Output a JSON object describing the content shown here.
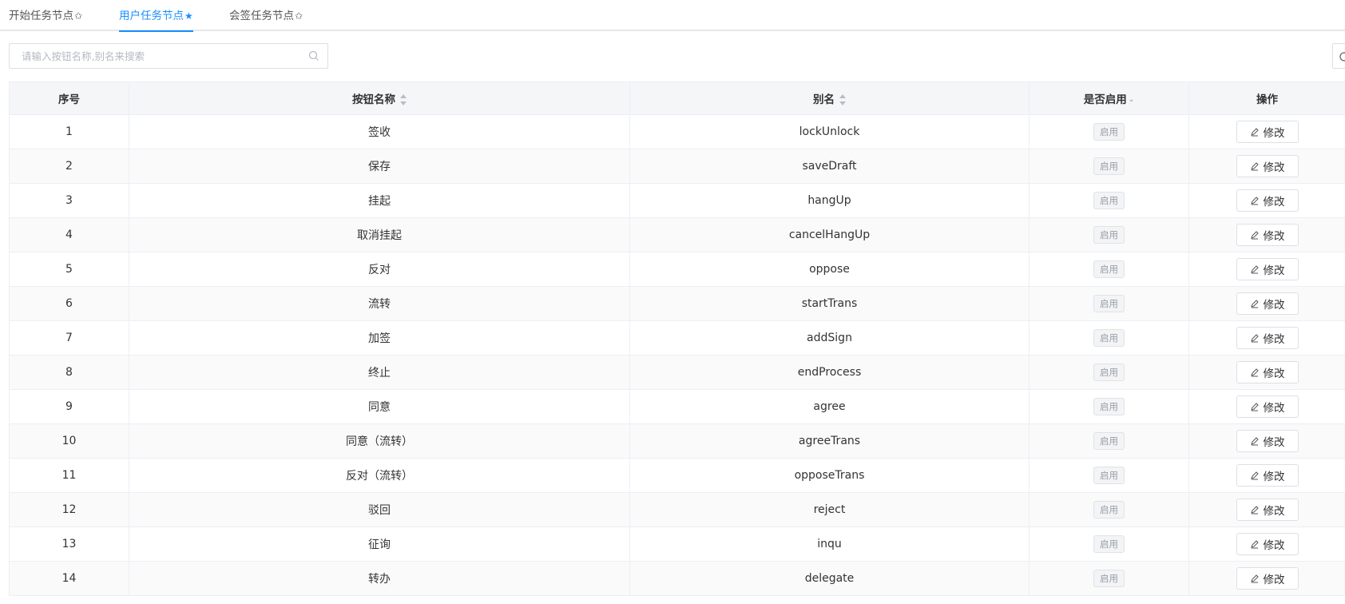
{
  "tabs": [
    {
      "label": "开始任务节点",
      "star": "✩",
      "active": false
    },
    {
      "label": "用户任务节点",
      "star": "★",
      "active": true
    },
    {
      "label": "会签任务节点",
      "star": "✩",
      "active": false
    }
  ],
  "search": {
    "placeholder": "请输入按钮名称,别名来搜索",
    "value": "",
    "icon": "search-icon"
  },
  "toolbar": {
    "refresh_icon": "refresh-icon"
  },
  "table": {
    "columns": [
      "序号",
      "按钮名称",
      "别名",
      "是否启用",
      "操作"
    ],
    "sortable_columns": [
      "按钮名称",
      "别名"
    ],
    "filter_column": "是否启用",
    "rows": [
      {
        "no": "1",
        "name": "签收",
        "alias": "lockUnlock",
        "status": "启用",
        "action": "修改"
      },
      {
        "no": "2",
        "name": "保存",
        "alias": "saveDraft",
        "status": "启用",
        "action": "修改"
      },
      {
        "no": "3",
        "name": "挂起",
        "alias": "hangUp",
        "status": "启用",
        "action": "修改"
      },
      {
        "no": "4",
        "name": "取消挂起",
        "alias": "cancelHangUp",
        "status": "启用",
        "action": "修改"
      },
      {
        "no": "5",
        "name": "反对",
        "alias": "oppose",
        "status": "启用",
        "action": "修改"
      },
      {
        "no": "6",
        "name": "流转",
        "alias": "startTrans",
        "status": "启用",
        "action": "修改"
      },
      {
        "no": "7",
        "name": "加签",
        "alias": "addSign",
        "status": "启用",
        "action": "修改"
      },
      {
        "no": "8",
        "name": "终止",
        "alias": "endProcess",
        "status": "启用",
        "action": "修改"
      },
      {
        "no": "9",
        "name": "同意",
        "alias": "agree",
        "status": "启用",
        "action": "修改"
      },
      {
        "no": "10",
        "name": "同意（流转）",
        "alias": "agreeTrans",
        "status": "启用",
        "action": "修改"
      },
      {
        "no": "11",
        "name": "反对（流转）",
        "alias": "opposeTrans",
        "status": "启用",
        "action": "修改"
      },
      {
        "no": "12",
        "name": "驳回",
        "alias": "reject",
        "status": "启用",
        "action": "修改"
      },
      {
        "no": "13",
        "name": "征询",
        "alias": "inqu",
        "status": "启用",
        "action": "修改"
      },
      {
        "no": "14",
        "name": "转办",
        "alias": "delegate",
        "status": "启用",
        "action": "修改"
      }
    ]
  },
  "colors": {
    "accent": "#1890ff",
    "header_bg": "#f5f6f8",
    "border": "#ebeef5"
  }
}
